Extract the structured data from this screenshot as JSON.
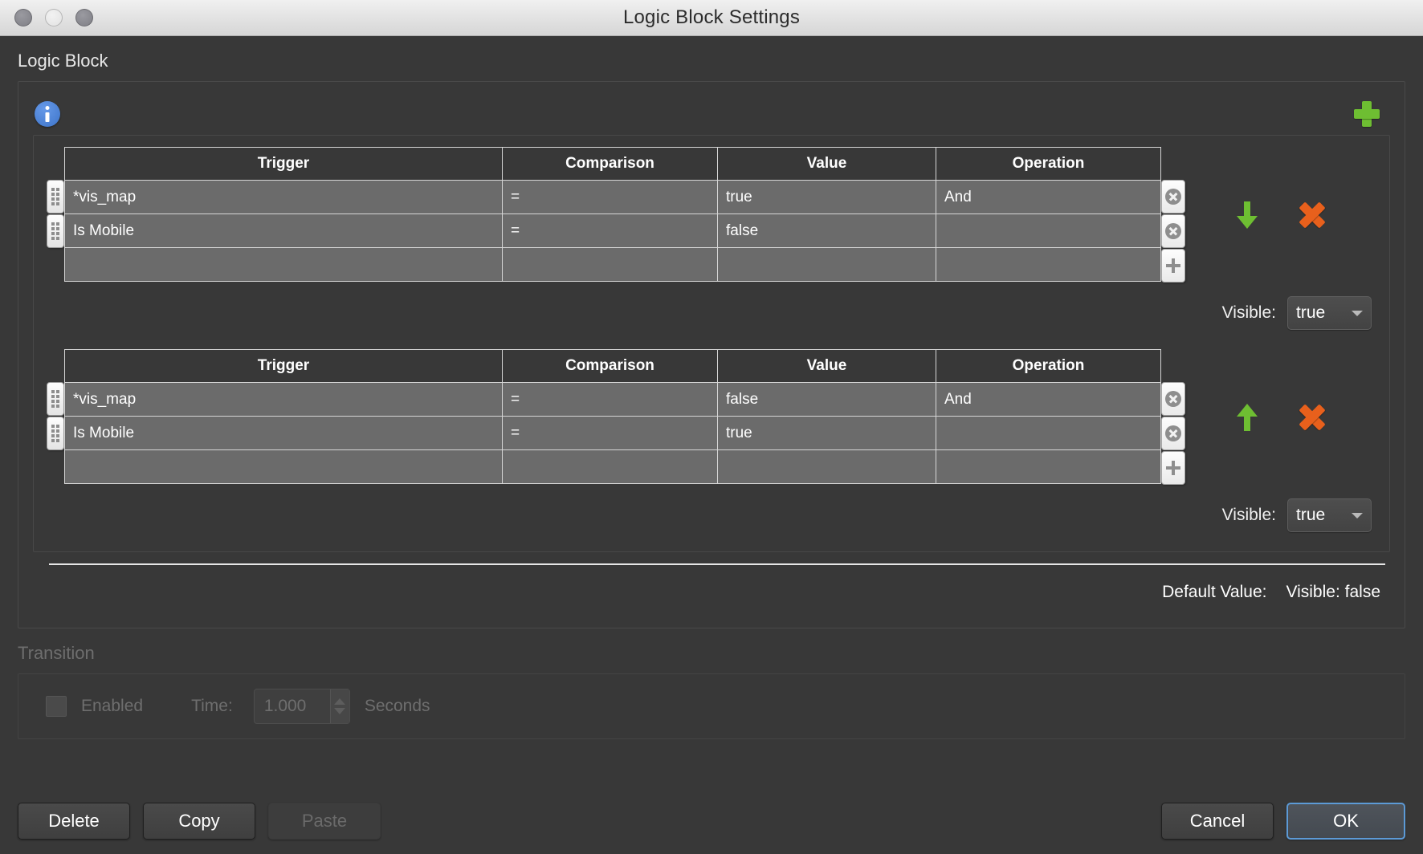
{
  "window": {
    "title": "Logic Block Settings",
    "traffic_lights": [
      "close",
      "minimize",
      "zoom"
    ]
  },
  "section": {
    "title": "Logic Block",
    "info_icon": "info-icon",
    "add_group_icon": "plus-icon"
  },
  "table_columns": [
    "Trigger",
    "Comparison",
    "Value",
    "Operation"
  ],
  "groups": [
    {
      "rows": [
        {
          "trigger": "*vis_map",
          "comparison": "=",
          "value": "true",
          "operation": "And"
        },
        {
          "trigger": "Is Mobile",
          "comparison": "=",
          "value": "false",
          "operation": ""
        },
        {
          "trigger": "",
          "comparison": "",
          "value": "",
          "operation": ""
        }
      ],
      "move_icon": "arrow-down-icon",
      "delete_icon": "x-icon",
      "visible_label": "Visible:",
      "visible_value": "true"
    },
    {
      "rows": [
        {
          "trigger": "*vis_map",
          "comparison": "=",
          "value": "false",
          "operation": "And"
        },
        {
          "trigger": "Is Mobile",
          "comparison": "=",
          "value": "true",
          "operation": ""
        },
        {
          "trigger": "",
          "comparison": "",
          "value": "",
          "operation": ""
        }
      ],
      "move_icon": "arrow-up-icon",
      "delete_icon": "x-icon",
      "visible_label": "Visible:",
      "visible_value": "true"
    }
  ],
  "default_value": {
    "label": "Default Value:",
    "property_label": "Visible:",
    "property_value": "false"
  },
  "transition": {
    "title": "Transition",
    "enabled_label": "Enabled",
    "enabled_checked": false,
    "time_label": "Time:",
    "time_value": "1.000",
    "seconds_label": "Seconds"
  },
  "footer": {
    "delete_label": "Delete",
    "copy_label": "Copy",
    "paste_label": "Paste",
    "cancel_label": "Cancel",
    "ok_label": "OK"
  },
  "colors": {
    "accent_green": "#6ebe32",
    "accent_orange": "#e8601c",
    "accent_blue": "#3d74c9",
    "focus_blue": "#5c9ad6",
    "row_fill": "#6b6b6b",
    "panel_bg": "#383838"
  }
}
